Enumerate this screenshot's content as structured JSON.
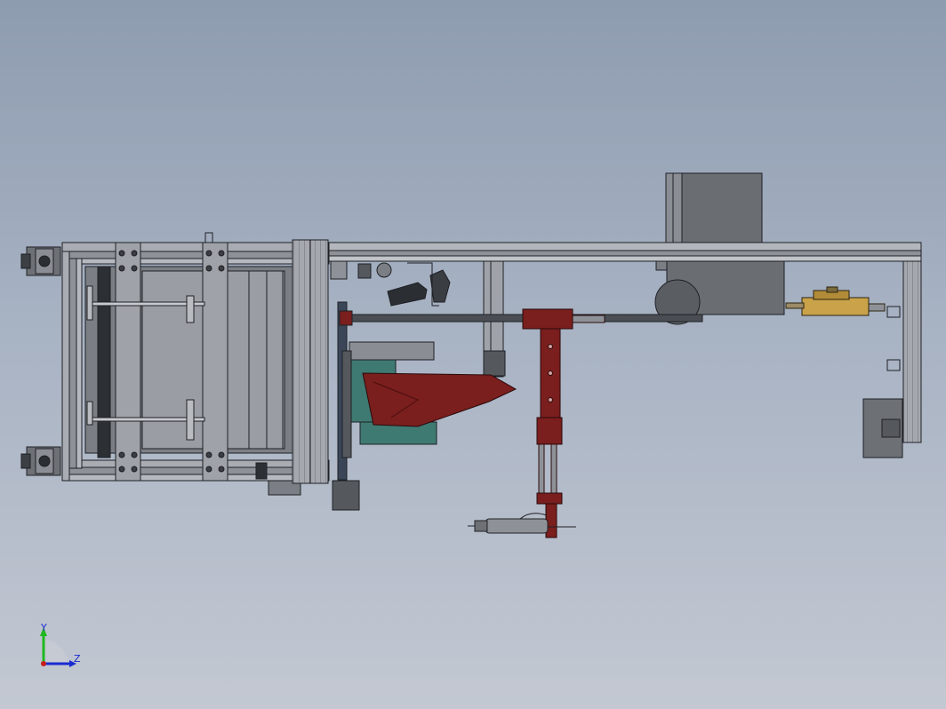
{
  "triad": {
    "y_label": "Y",
    "z_label": "Z",
    "y_color": "#1fb81f",
    "z_color": "#1a2bd0"
  },
  "colors": {
    "frame_light": "#a9adb3",
    "frame_dark": "#4d5157",
    "outline": "#1e2024",
    "maroon": "#7a1e1e",
    "teal": "#3f7a72",
    "gold": "#c9a24a",
    "panel": "#6a6d72"
  }
}
